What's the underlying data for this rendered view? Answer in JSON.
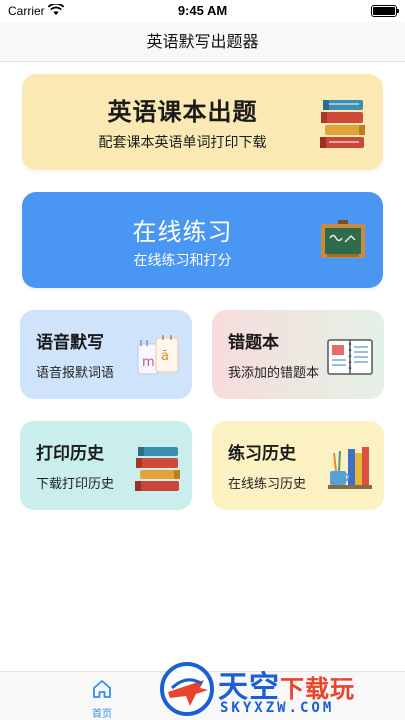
{
  "status_bar": {
    "carrier": "Carrier",
    "time": "9:45 AM"
  },
  "nav": {
    "title": "英语默写出题器"
  },
  "cards": {
    "textbook": {
      "title": "英语课本出题",
      "subtitle": "配套课本英语单词打印下载",
      "icon": "books-stack-icon"
    },
    "practice": {
      "title": "在线练习",
      "subtitle": "在线练习和打分",
      "icon": "chalkboard-icon"
    },
    "dictation": {
      "title": "语音默写",
      "subtitle": "语音报默词语",
      "icon": "pinyin-cards-icon"
    },
    "mistakes": {
      "title": "错题本",
      "subtitle": "我添加的错题本",
      "icon": "notebook-icon"
    },
    "print_history": {
      "title": "打印历史",
      "subtitle": "下载打印历史",
      "icon": "books-stack-icon"
    },
    "practice_history": {
      "title": "练习历史",
      "subtitle": "在线练习历史",
      "icon": "desk-supplies-icon"
    }
  },
  "tabbar": {
    "home_label": "首页",
    "active_color": "#2e8df6"
  },
  "watermark": {
    "brand": "天空",
    "brand_suffix": "下载玩",
    "domain": "SKYXZW.COM"
  },
  "colors": {
    "yellow_card": "#fbe9b3",
    "blue_card": "#4a96f3",
    "light_blue_card": "#cfe3fb",
    "teal_card": "#c9eeec",
    "cream_card": "#fbf1c3"
  }
}
